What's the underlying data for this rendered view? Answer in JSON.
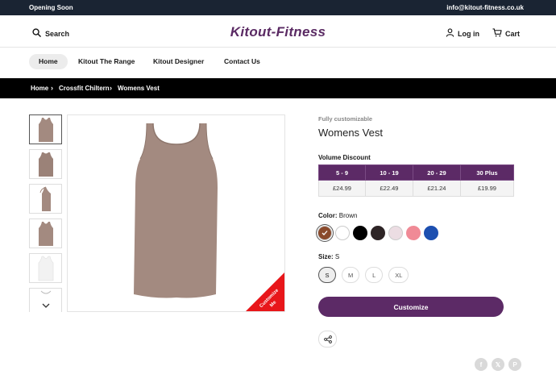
{
  "topbar": {
    "left": "Opening Soon",
    "right": "info@kitout-fitness.co.uk"
  },
  "header": {
    "search_label": "Search",
    "logo": "Kitout-Fitness",
    "login_label": "Log in",
    "cart_label": "Cart"
  },
  "nav": {
    "items": [
      "Home",
      "Kitout The Range",
      "Kitout Designer",
      "Contact Us"
    ],
    "active": "Home"
  },
  "breadcrumb": {
    "items": [
      "Home",
      "Crossfit Chiltern",
      "Womens Vest"
    ]
  },
  "product": {
    "tagline": "Fully customizable",
    "title": "Womens Vest",
    "ribbon_text_line1": "Customize",
    "ribbon_text_line2": "Me",
    "volume_discount": {
      "label": "Volume Discount",
      "tiers": [
        "5 - 9",
        "10 - 19",
        "20 - 29",
        "30 Plus"
      ],
      "prices": [
        "£24.99",
        "£22.49",
        "£21.24",
        "£19.99"
      ]
    },
    "color": {
      "label": "Color:",
      "selected": "Brown",
      "swatches": [
        "#8a4a2c",
        "#ffffff",
        "#000000",
        "#2e2526",
        "#ecdde3",
        "#f08a96",
        "#1d4fb0"
      ]
    },
    "size": {
      "label": "Size:",
      "selected": "S",
      "options": [
        "S",
        "M",
        "L",
        "XL"
      ]
    },
    "customize_label": "Customize"
  },
  "colors": {
    "accent": "#5c2a66",
    "topbar": "#1a2433",
    "ribbon": "#e8161a",
    "garment": "#a38a80"
  }
}
